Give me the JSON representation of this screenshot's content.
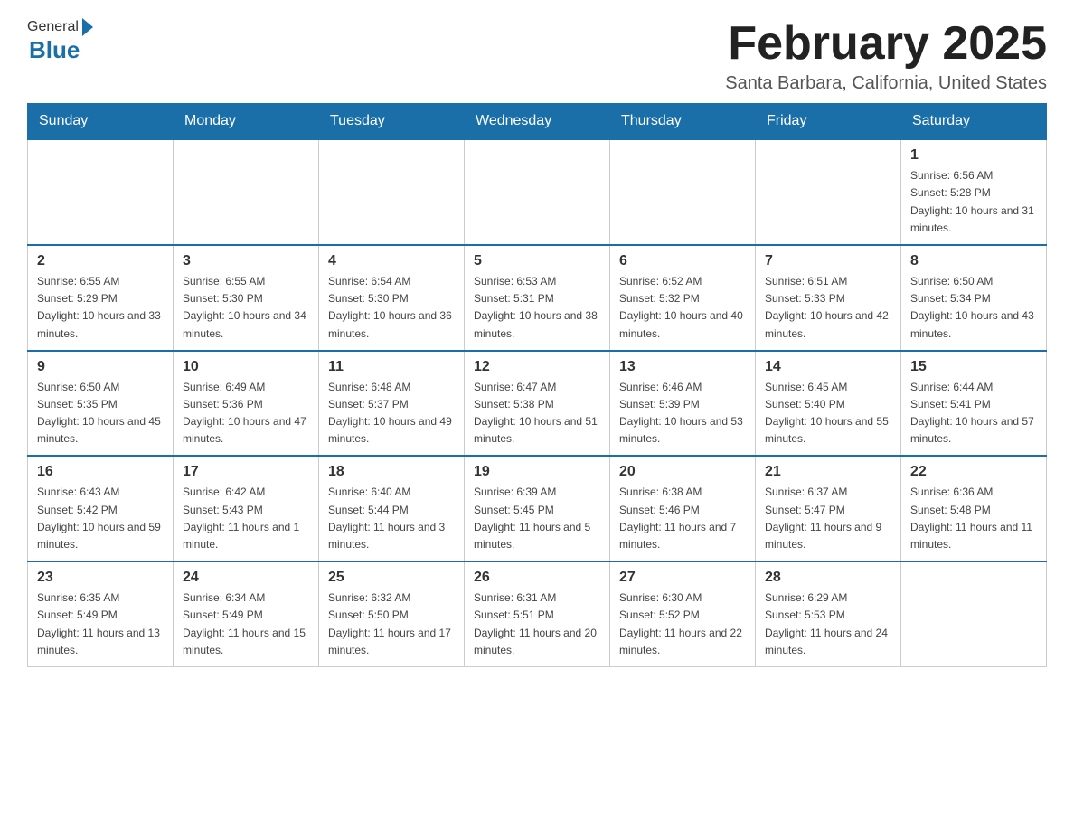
{
  "header": {
    "logo": {
      "general": "General",
      "blue": "Blue"
    },
    "title": "February 2025",
    "subtitle": "Santa Barbara, California, United States"
  },
  "days_of_week": [
    "Sunday",
    "Monday",
    "Tuesday",
    "Wednesday",
    "Thursday",
    "Friday",
    "Saturday"
  ],
  "weeks": [
    [
      {
        "day": "",
        "info": ""
      },
      {
        "day": "",
        "info": ""
      },
      {
        "day": "",
        "info": ""
      },
      {
        "day": "",
        "info": ""
      },
      {
        "day": "",
        "info": ""
      },
      {
        "day": "",
        "info": ""
      },
      {
        "day": "1",
        "info": "Sunrise: 6:56 AM\nSunset: 5:28 PM\nDaylight: 10 hours and 31 minutes."
      }
    ],
    [
      {
        "day": "2",
        "info": "Sunrise: 6:55 AM\nSunset: 5:29 PM\nDaylight: 10 hours and 33 minutes."
      },
      {
        "day": "3",
        "info": "Sunrise: 6:55 AM\nSunset: 5:30 PM\nDaylight: 10 hours and 34 minutes."
      },
      {
        "day": "4",
        "info": "Sunrise: 6:54 AM\nSunset: 5:30 PM\nDaylight: 10 hours and 36 minutes."
      },
      {
        "day": "5",
        "info": "Sunrise: 6:53 AM\nSunset: 5:31 PM\nDaylight: 10 hours and 38 minutes."
      },
      {
        "day": "6",
        "info": "Sunrise: 6:52 AM\nSunset: 5:32 PM\nDaylight: 10 hours and 40 minutes."
      },
      {
        "day": "7",
        "info": "Sunrise: 6:51 AM\nSunset: 5:33 PM\nDaylight: 10 hours and 42 minutes."
      },
      {
        "day": "8",
        "info": "Sunrise: 6:50 AM\nSunset: 5:34 PM\nDaylight: 10 hours and 43 minutes."
      }
    ],
    [
      {
        "day": "9",
        "info": "Sunrise: 6:50 AM\nSunset: 5:35 PM\nDaylight: 10 hours and 45 minutes."
      },
      {
        "day": "10",
        "info": "Sunrise: 6:49 AM\nSunset: 5:36 PM\nDaylight: 10 hours and 47 minutes."
      },
      {
        "day": "11",
        "info": "Sunrise: 6:48 AM\nSunset: 5:37 PM\nDaylight: 10 hours and 49 minutes."
      },
      {
        "day": "12",
        "info": "Sunrise: 6:47 AM\nSunset: 5:38 PM\nDaylight: 10 hours and 51 minutes."
      },
      {
        "day": "13",
        "info": "Sunrise: 6:46 AM\nSunset: 5:39 PM\nDaylight: 10 hours and 53 minutes."
      },
      {
        "day": "14",
        "info": "Sunrise: 6:45 AM\nSunset: 5:40 PM\nDaylight: 10 hours and 55 minutes."
      },
      {
        "day": "15",
        "info": "Sunrise: 6:44 AM\nSunset: 5:41 PM\nDaylight: 10 hours and 57 minutes."
      }
    ],
    [
      {
        "day": "16",
        "info": "Sunrise: 6:43 AM\nSunset: 5:42 PM\nDaylight: 10 hours and 59 minutes."
      },
      {
        "day": "17",
        "info": "Sunrise: 6:42 AM\nSunset: 5:43 PM\nDaylight: 11 hours and 1 minute."
      },
      {
        "day": "18",
        "info": "Sunrise: 6:40 AM\nSunset: 5:44 PM\nDaylight: 11 hours and 3 minutes."
      },
      {
        "day": "19",
        "info": "Sunrise: 6:39 AM\nSunset: 5:45 PM\nDaylight: 11 hours and 5 minutes."
      },
      {
        "day": "20",
        "info": "Sunrise: 6:38 AM\nSunset: 5:46 PM\nDaylight: 11 hours and 7 minutes."
      },
      {
        "day": "21",
        "info": "Sunrise: 6:37 AM\nSunset: 5:47 PM\nDaylight: 11 hours and 9 minutes."
      },
      {
        "day": "22",
        "info": "Sunrise: 6:36 AM\nSunset: 5:48 PM\nDaylight: 11 hours and 11 minutes."
      }
    ],
    [
      {
        "day": "23",
        "info": "Sunrise: 6:35 AM\nSunset: 5:49 PM\nDaylight: 11 hours and 13 minutes."
      },
      {
        "day": "24",
        "info": "Sunrise: 6:34 AM\nSunset: 5:49 PM\nDaylight: 11 hours and 15 minutes."
      },
      {
        "day": "25",
        "info": "Sunrise: 6:32 AM\nSunset: 5:50 PM\nDaylight: 11 hours and 17 minutes."
      },
      {
        "day": "26",
        "info": "Sunrise: 6:31 AM\nSunset: 5:51 PM\nDaylight: 11 hours and 20 minutes."
      },
      {
        "day": "27",
        "info": "Sunrise: 6:30 AM\nSunset: 5:52 PM\nDaylight: 11 hours and 22 minutes."
      },
      {
        "day": "28",
        "info": "Sunrise: 6:29 AM\nSunset: 5:53 PM\nDaylight: 11 hours and 24 minutes."
      },
      {
        "day": "",
        "info": ""
      }
    ]
  ]
}
